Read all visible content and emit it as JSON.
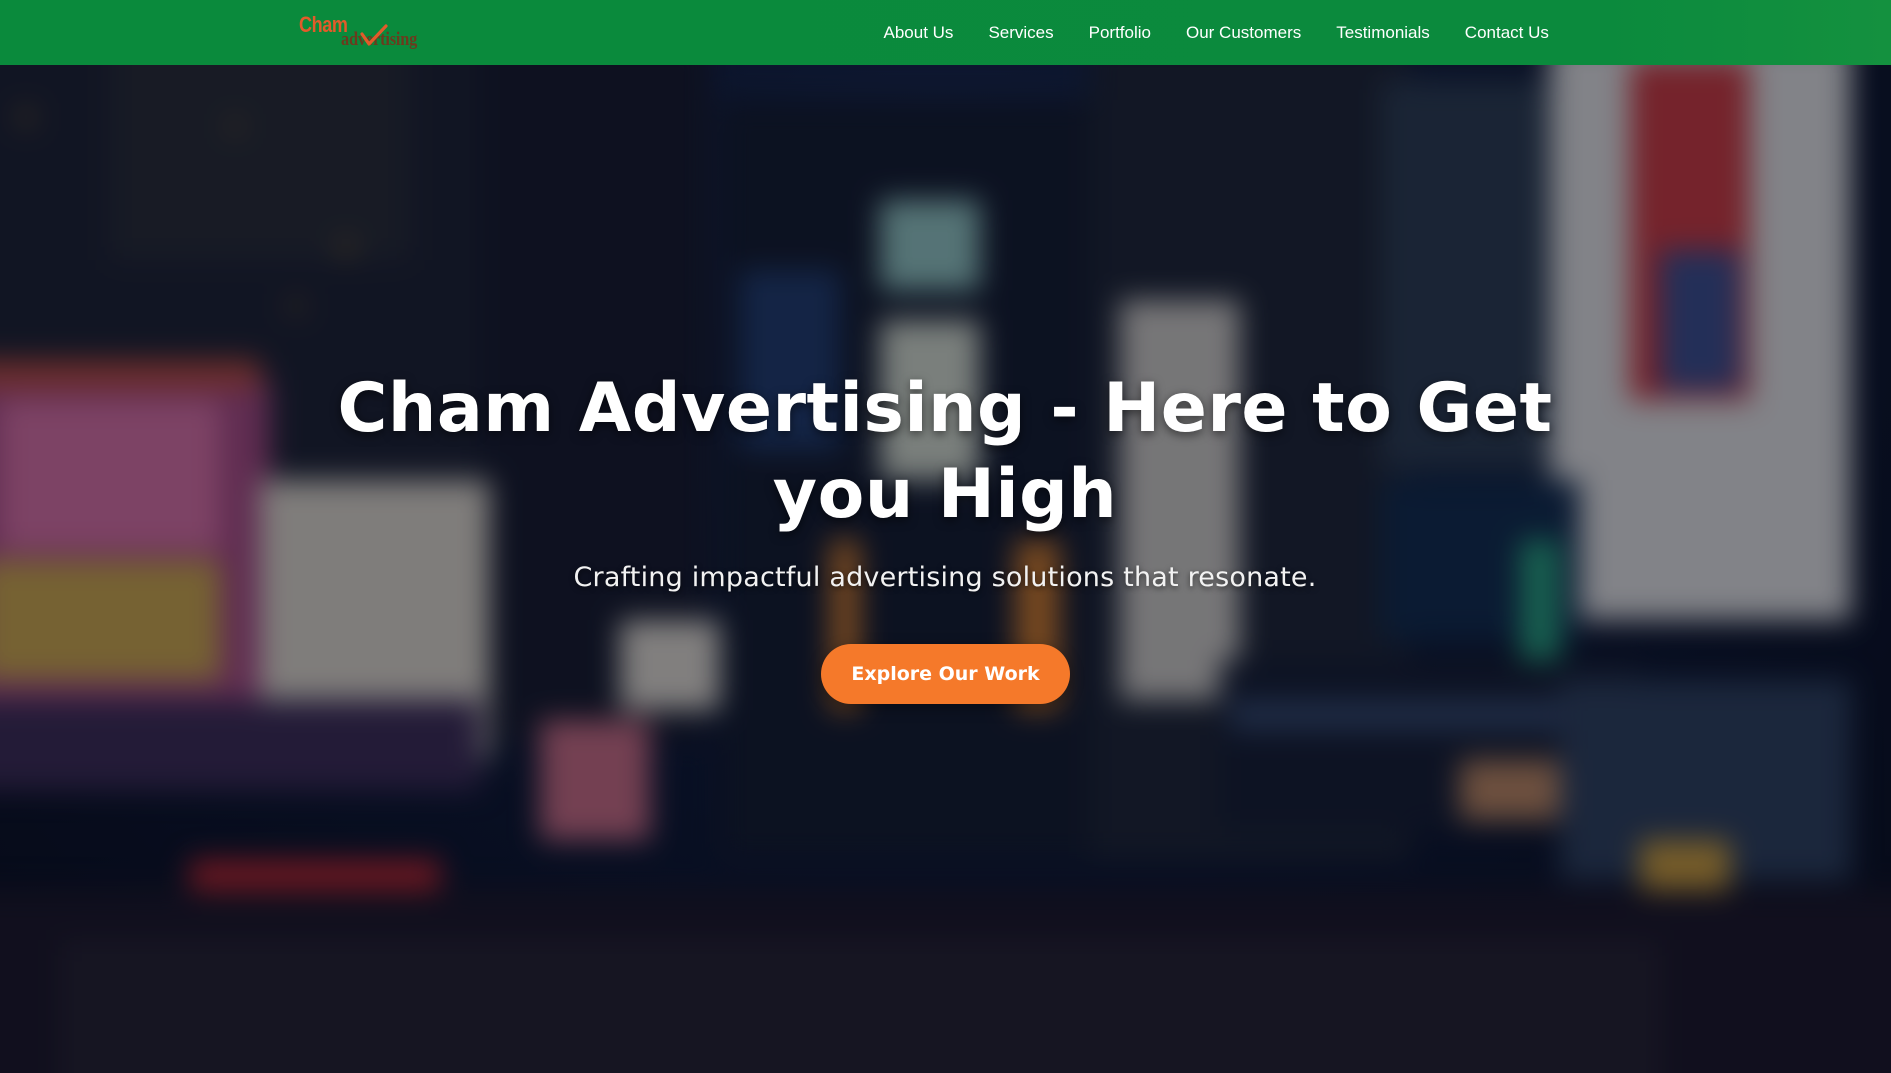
{
  "brand": {
    "logo_word_1": "Cham",
    "logo_word_2": "advertising",
    "primary_color": "#0b8a3d",
    "accent_color": "#f5792a"
  },
  "nav": {
    "items": [
      {
        "label": "About Us"
      },
      {
        "label": "Services"
      },
      {
        "label": "Portfolio"
      },
      {
        "label": "Our Customers"
      },
      {
        "label": "Testimonials"
      },
      {
        "label": "Contact Us"
      }
    ]
  },
  "hero": {
    "title": "Cham Advertising - Here to Get you High",
    "subtitle": "Crafting impactful advertising solutions that resonate.",
    "cta_label": "Explore Our Work"
  }
}
